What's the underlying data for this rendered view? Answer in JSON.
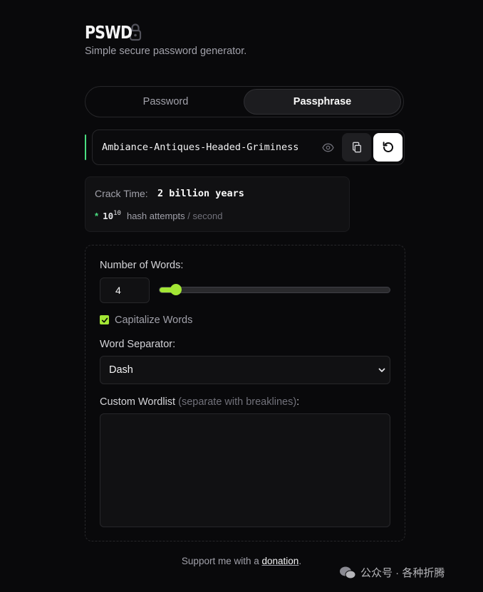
{
  "brand": {
    "title": "PSWD",
    "subtitle": "Simple secure password generator."
  },
  "tabs": [
    {
      "label": "Password",
      "active": false
    },
    {
      "label": "Passphrase",
      "active": true
    }
  ],
  "password": {
    "value": "Ambiance-Antiques-Headed-Griminess",
    "accent_color": "#4ade80"
  },
  "crack": {
    "label": "Crack Time:",
    "value": "2 billion years",
    "hash_base": "10",
    "hash_exponent": "10",
    "hash_text": "hash attempts",
    "hash_sep": "/",
    "hash_unit": "second"
  },
  "options": {
    "words_label": "Number of Words:",
    "words_value": "4",
    "words_slider_fraction": 0.06,
    "capitalize_label": "Capitalize Words",
    "capitalize_checked": true,
    "separator_label": "Word Separator:",
    "separator_value": "Dash",
    "wordlist_label": "Custom Wordlist",
    "wordlist_hint": "(separate with breaklines)",
    "wordlist_colon": ":",
    "wordlist_value": ""
  },
  "footer": {
    "text": "Support me with a",
    "link": "donation",
    "period": "."
  },
  "watermark": {
    "text": "公众号 · 各种折腾"
  },
  "colors": {
    "accent": "#a3e635",
    "background": "#09090b"
  }
}
